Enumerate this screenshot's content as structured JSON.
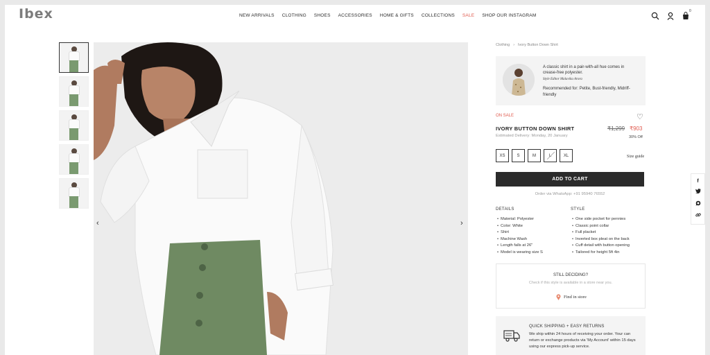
{
  "header": {
    "logo": "Ibex",
    "nav": [
      "NEW ARRIVALS",
      "CLOTHING",
      "SHOES",
      "ACCESSORIES",
      "HOME & GIFTS",
      "COLLECTIONS",
      "SALE",
      "SHOP OUR INSTAGRAM"
    ],
    "cart_count": "0",
    "icons": [
      "search-icon",
      "user-icon",
      "cart-icon"
    ]
  },
  "breadcrumb": {
    "items": [
      "Clothing",
      "Ivory Button Down Shirt"
    ],
    "separator": "›"
  },
  "editor": {
    "quote": "A classic shirt in a pair-with-all hue comes in crease-free polyester.",
    "name": "Style Editor Malavika Arora",
    "recommendation": "Recommended for: Petite, Bust-friendly, Midriff-friendly"
  },
  "product": {
    "badge": "ON SALE",
    "name": "IVORY BUTTON DOWN SHIRT",
    "delivery": "Estimated Delivery: Monday, 20 January",
    "mrp": "₹1,299",
    "price": "₹903",
    "discount": "30% Off",
    "sizes": [
      "XS",
      "S",
      "M",
      "L",
      "XL"
    ],
    "unavailable_size": "L",
    "size_guide": "Size guide",
    "add_to_cart": "ADD TO CART",
    "whatsapp": "Order via WhatsApp: +91 95940 76552"
  },
  "details": {
    "heading": "DETAILS",
    "items": [
      "Material: Polyester",
      "Color: White",
      "Shirt",
      "Machine Wash",
      "Length falls at 26\"",
      "Model is wearing size S"
    ]
  },
  "style": {
    "heading": "STYLE",
    "items": [
      "One side pocket for pennies",
      "Classic point collar",
      "Full placket",
      "Inverted box pleat on the back",
      "Cuff detail with button opening",
      "Tailored for height 5ft 4in"
    ]
  },
  "still_deciding": {
    "title": "STILL DECIDING?",
    "subtitle": "Check if this style is available in a store near you.",
    "link": "Find in store"
  },
  "shipping": {
    "title": "QUICK SHIPPING + EASY RETURNS",
    "text": "We ship within 24 hours of receiving your order. Your can return or exchange products via 'My Account' within 15 days using our express pick-up service."
  },
  "social": [
    "f",
    "t",
    "w",
    "link"
  ],
  "colors": {
    "accent": "#e05a4e",
    "button": "#2b2b2b",
    "pants": "#6f8a62"
  }
}
